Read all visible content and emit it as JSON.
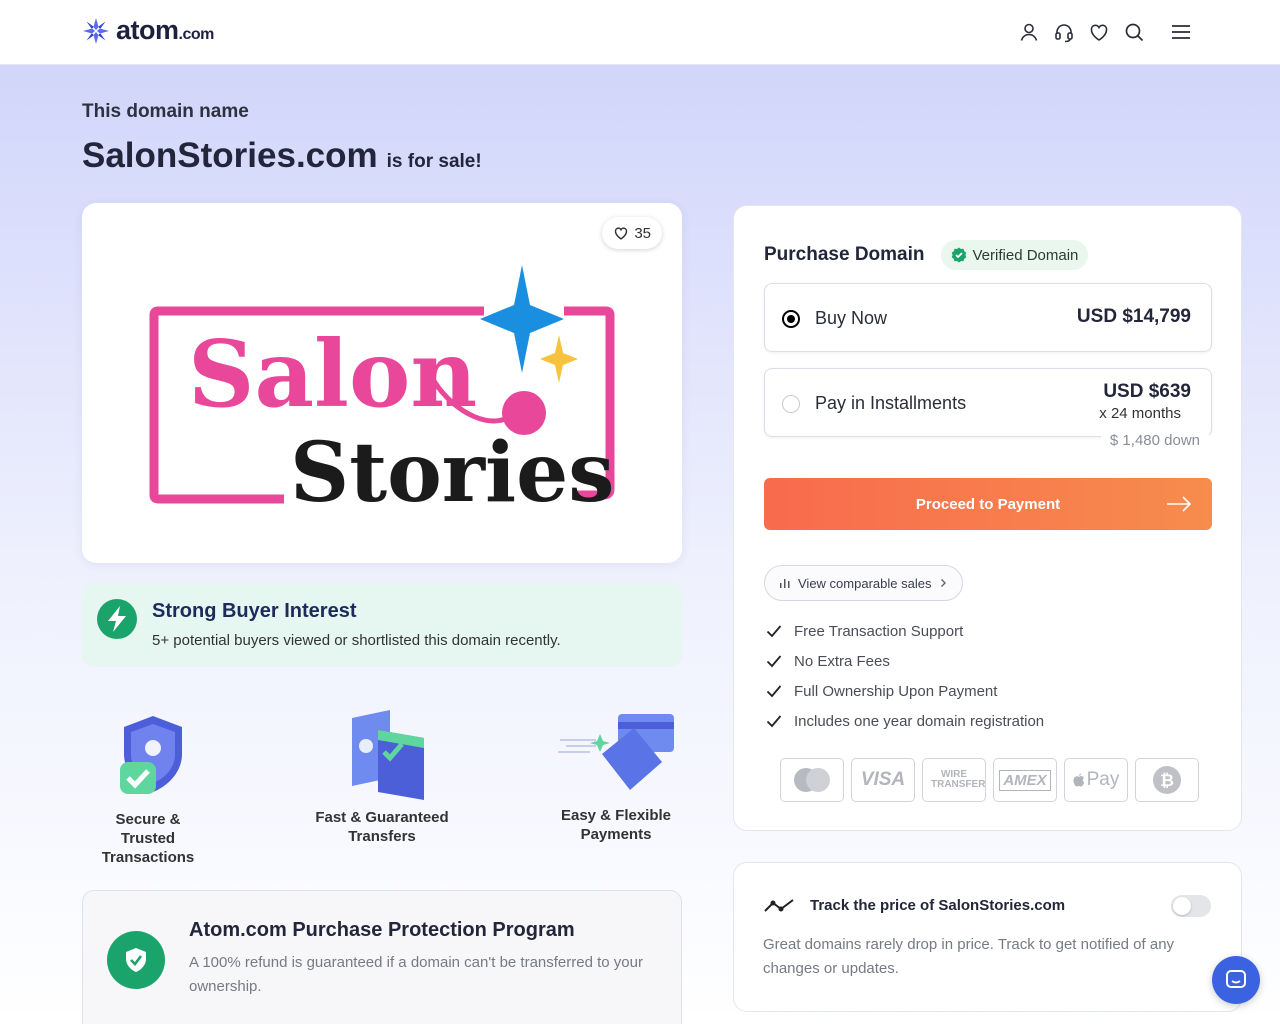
{
  "header": {
    "logo_text": "atom",
    "logo_suffix": ".com",
    "icons": [
      "user-icon",
      "headset-icon",
      "heart-icon",
      "search-icon",
      "menu-icon"
    ]
  },
  "hero": {
    "eyebrow": "This domain name",
    "domain": "SalonStories.com",
    "suffix": "is for sale!"
  },
  "logo_card": {
    "likes": "35",
    "brand_line1": "Salon",
    "brand_line2": "Stories"
  },
  "interest": {
    "title": "Strong Buyer Interest",
    "text": "5+ potential buyers viewed or shortlisted this domain recently."
  },
  "features": [
    {
      "line1": "Secure & Trusted",
      "line2": "Transactions"
    },
    {
      "line1": "Fast & Guaranteed",
      "line2": "Transfers"
    },
    {
      "line1": "Easy & Flexible",
      "line2": "Payments"
    }
  ],
  "protection": {
    "title": "Atom.com Purchase Protection Program",
    "text": "A 100% refund is guaranteed if a domain can't be transferred to your ownership."
  },
  "purchase": {
    "title": "Purchase Domain",
    "verified": "Verified Domain",
    "buy_now_label": "Buy Now",
    "buy_now_price": "USD $14,799",
    "installments_label": "Pay in Installments",
    "installments_price": "USD $639",
    "installments_months": "x 24 months",
    "installments_down": "$ 1,480 down",
    "proceed_label": "Proceed to Payment",
    "comparable_label": "View comparable sales",
    "checks": [
      "Free Transaction Support",
      "No Extra Fees",
      "Full Ownership Upon Payment",
      "Includes one year domain registration"
    ],
    "payment_methods": [
      "Mastercard",
      "VISA",
      "WIRE TRANSFER",
      "AMEX",
      "Pay",
      "Bitcoin"
    ]
  },
  "track": {
    "title": "Track the price of SalonStories.com",
    "text": "Great domains rarely drop in price. Track to get notified of any changes or updates.",
    "enabled": false
  },
  "colors": {
    "accent": "#f86b4d",
    "brand_pink": "#e8479a",
    "success": "#1aa36b",
    "chat": "#3b62e0"
  }
}
